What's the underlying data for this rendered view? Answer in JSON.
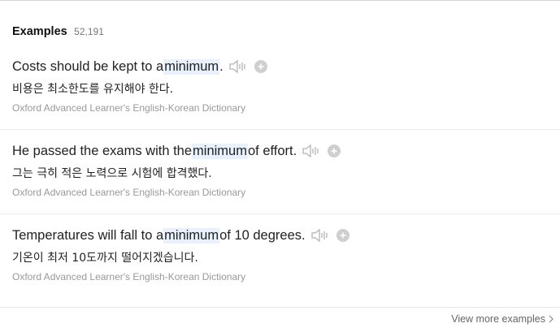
{
  "section": {
    "title": "Examples",
    "count": "52,191"
  },
  "examples": [
    {
      "before": "Costs should be kept to a ",
      "highlight": "minimum",
      "after": ".",
      "translation": "비용은 최소한도를 유지해야 한다.",
      "source": "Oxford Advanced Learner's English-Korean Dictionary",
      "icons": [
        "speaker-icon",
        "add-icon"
      ]
    },
    {
      "before": "He passed the exams with the ",
      "highlight": "minimum",
      "after": " of effort.",
      "translation": "그는 극히 적은 노력으로 시험에 합격했다.",
      "source": "Oxford Advanced Learner's English-Korean Dictionary",
      "icons": [
        "speaker-icon",
        "add-icon"
      ]
    },
    {
      "before": "Temperatures will fall to a ",
      "highlight": "minimum",
      "after": " of 10 degrees.",
      "translation": "기온이 최저 10도까지 떨어지겠습니다.",
      "source": "Oxford Advanced Learner's English-Korean Dictionary",
      "icons": [
        "speaker-icon",
        "add-icon"
      ]
    }
  ],
  "footer": {
    "more_label": "View more examples"
  },
  "colors": {
    "highlight": "#e8f1fc",
    "icon": "#b5b5b5",
    "source_text": "#999999"
  }
}
